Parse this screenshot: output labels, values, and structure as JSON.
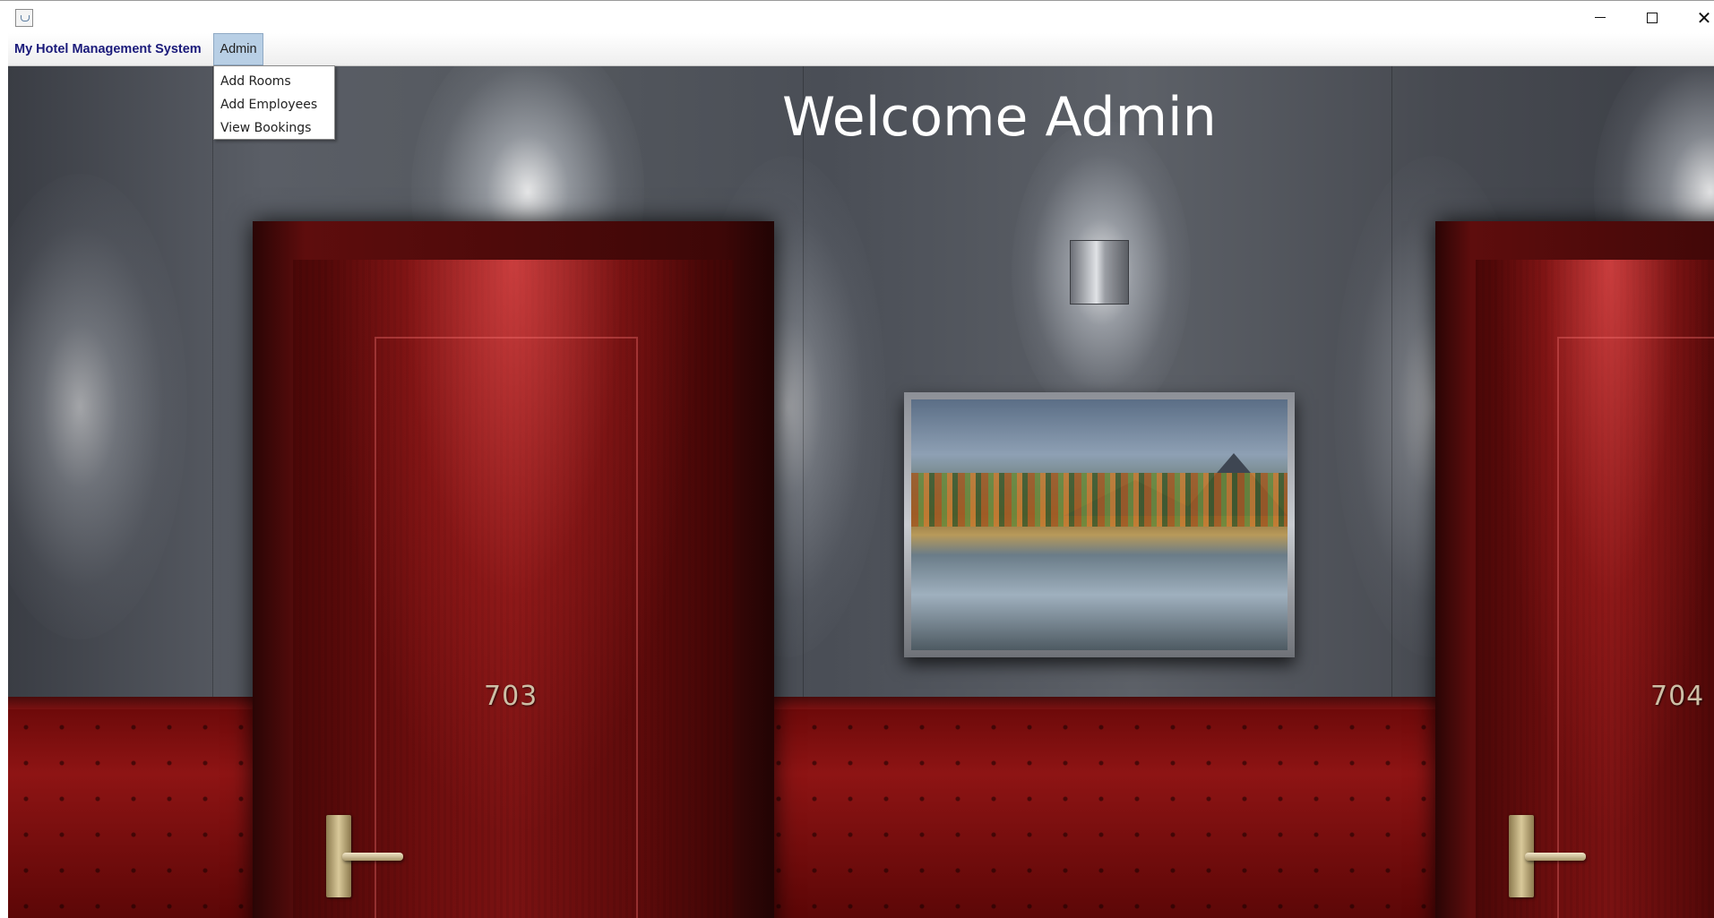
{
  "window": {
    "title": "",
    "icons": {
      "app": "java-icon",
      "minimize": "minimize-icon",
      "maximize": "maximize-icon",
      "close": "close-icon"
    },
    "close_glyph": "✕"
  },
  "menubar": {
    "title": "My Hotel Management System",
    "admin_menu": "Admin"
  },
  "admin_popup": {
    "items": [
      {
        "label": "Add Rooms"
      },
      {
        "label": "Add Employees"
      },
      {
        "label": "View Bookings"
      }
    ]
  },
  "main": {
    "welcome_text": "Welcome Admin",
    "room_numbers": [
      "703",
      "704"
    ]
  },
  "colors": {
    "menu_title": "#1a1a7a",
    "admin_menu_selected": "#b8cfe5",
    "door_red": "#6e0e0e",
    "welcome_text": "#ffffff"
  }
}
